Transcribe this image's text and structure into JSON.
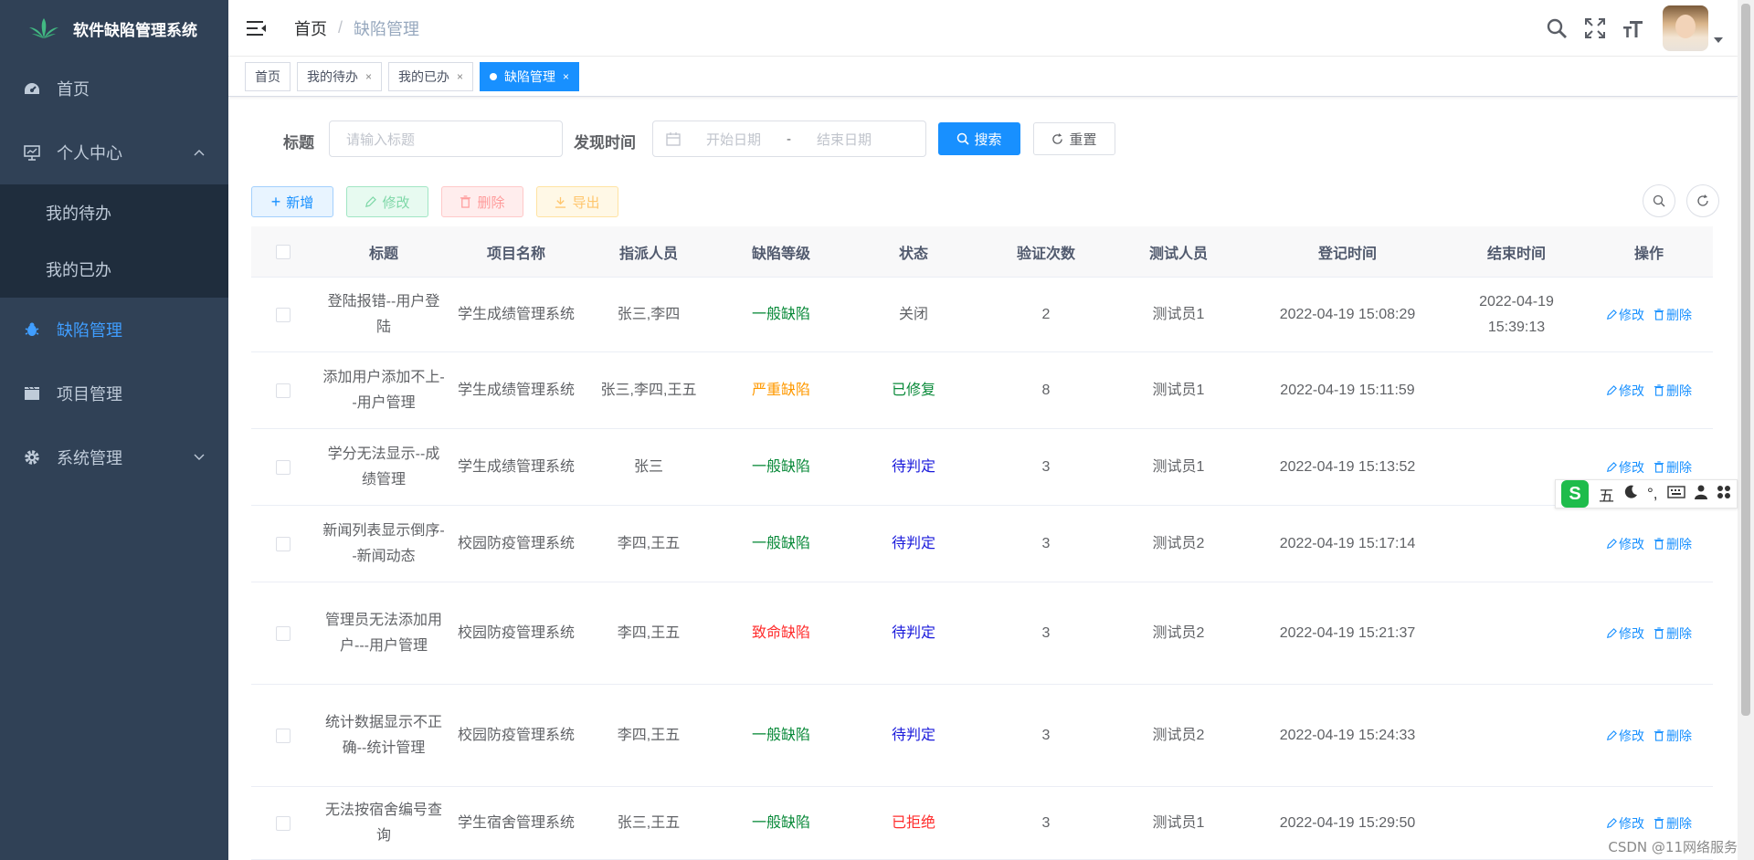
{
  "app": {
    "title": "软件缺陷管理系统"
  },
  "sidebar": {
    "items": [
      {
        "label": "首页"
      },
      {
        "label": "个人中心"
      },
      {
        "label": "缺陷管理"
      },
      {
        "label": "项目管理"
      },
      {
        "label": "系统管理"
      }
    ],
    "sub_items": [
      {
        "label": "我的待办"
      },
      {
        "label": "我的已办"
      }
    ]
  },
  "breadcrumb": {
    "home": "首页",
    "sep": "/",
    "current": "缺陷管理"
  },
  "tags": [
    {
      "label": "首页"
    },
    {
      "label": "我的待办"
    },
    {
      "label": "我的已办"
    },
    {
      "label": "缺陷管理"
    }
  ],
  "search": {
    "title_label": "标题",
    "title_placeholder": "请输入标题",
    "time_label": "发现时间",
    "start_placeholder": "开始日期",
    "range_sep": "-",
    "end_placeholder": "结束日期",
    "search_btn": "搜索",
    "reset_btn": "重置"
  },
  "toolbar": {
    "add": "新增",
    "edit": "修改",
    "delete": "删除",
    "export": "导出"
  },
  "table": {
    "headers": [
      "标题",
      "项目名称",
      "指派人员",
      "缺陷等级",
      "状态",
      "验证次数",
      "测试人员",
      "登记时间",
      "结束时间",
      "操作"
    ],
    "op_edit": "修改",
    "op_delete": "删除",
    "rows": [
      {
        "title": "登陆报错--用户登陆",
        "project": "学生成绩管理系统",
        "assignee": "张三,李四",
        "level": "一般缺陷",
        "status": "关闭",
        "count": "2",
        "tester": "测试员1",
        "reg_time": "2022-04-19 15:08:29",
        "end_time": "2022-04-19 15:39:13"
      },
      {
        "title": "添加用户添加不上--用户管理",
        "project": "学生成绩管理系统",
        "assignee": "张三,李四,王五",
        "level": "严重缺陷",
        "status": "已修复",
        "count": "8",
        "tester": "测试员1",
        "reg_time": "2022-04-19 15:11:59",
        "end_time": ""
      },
      {
        "title": "学分无法显示--成绩管理",
        "project": "学生成绩管理系统",
        "assignee": "张三",
        "level": "一般缺陷",
        "status": "待判定",
        "count": "3",
        "tester": "测试员1",
        "reg_time": "2022-04-19 15:13:52",
        "end_time": ""
      },
      {
        "title": "新闻列表显示倒序--新闻动态",
        "project": "校园防疫管理系统",
        "assignee": "李四,王五",
        "level": "一般缺陷",
        "status": "待判定",
        "count": "3",
        "tester": "测试员2",
        "reg_time": "2022-04-19 15:17:14",
        "end_time": ""
      },
      {
        "title": "管理员无法添加用户---用户管理",
        "project": "校园防疫管理系统",
        "assignee": "李四,王五",
        "level": "致命缺陷",
        "status": "待判定",
        "count": "3",
        "tester": "测试员2",
        "reg_time": "2022-04-19 15:21:37",
        "end_time": ""
      },
      {
        "title": "统计数据显示不正确--统计管理",
        "project": "校园防疫管理系统",
        "assignee": "李四,王五",
        "level": "一般缺陷",
        "status": "待判定",
        "count": "3",
        "tester": "测试员2",
        "reg_time": "2022-04-19 15:24:33",
        "end_time": ""
      },
      {
        "title": "无法按宿舍编号查询",
        "project": "学生宿舍管理系统",
        "assignee": "张三,王五",
        "level": "一般缺陷",
        "status": "已拒绝",
        "count": "3",
        "tester": "测试员1",
        "reg_time": "2022-04-19 15:29:50",
        "end_time": ""
      }
    ]
  },
  "ime": {
    "logo": "S",
    "mode": "五",
    "punct": "°,"
  },
  "watermark": "CSDN @11网络服务"
}
